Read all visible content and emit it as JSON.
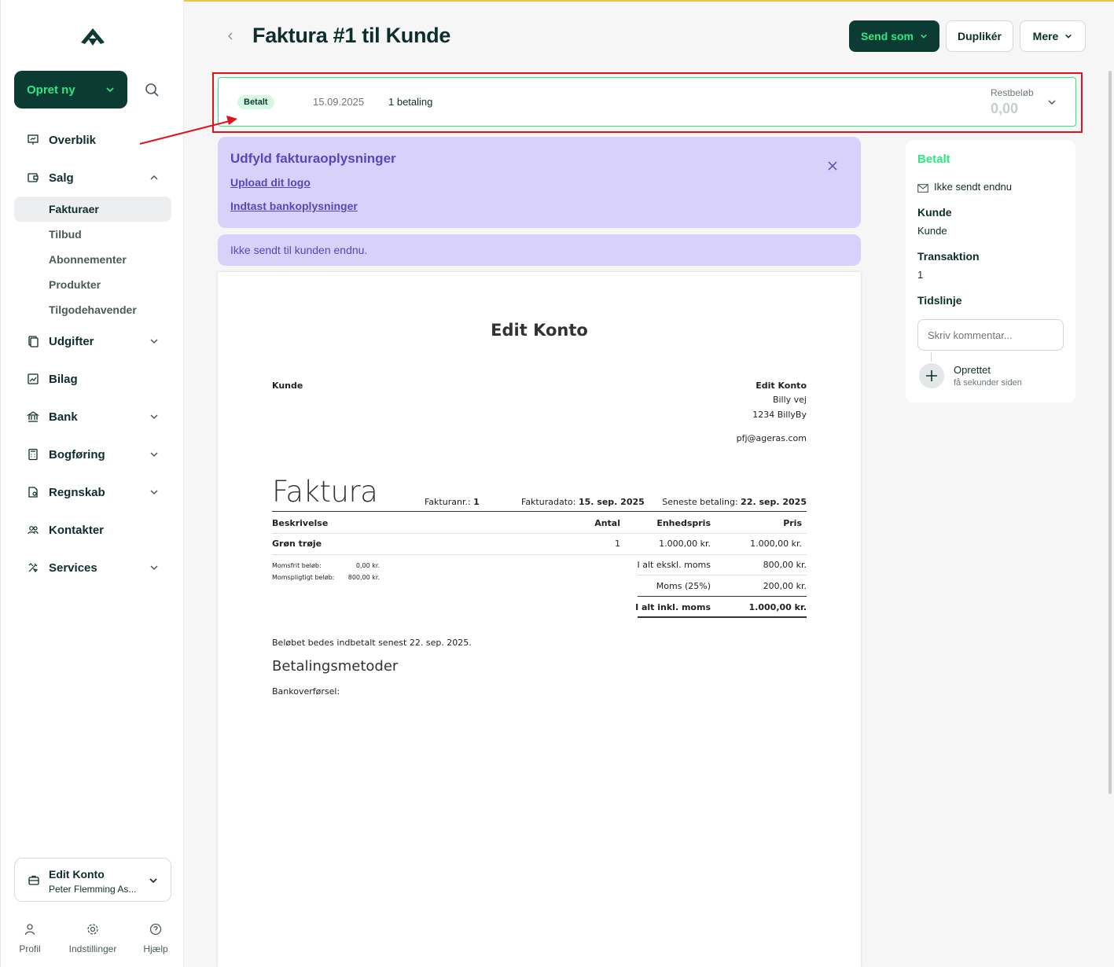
{
  "sidebar": {
    "create_label": "Opret ny",
    "items": [
      {
        "label": "Overblik"
      },
      {
        "label": "Salg"
      },
      {
        "label": "Udgifter"
      },
      {
        "label": "Bilag"
      },
      {
        "label": "Bank"
      },
      {
        "label": "Bogføring"
      },
      {
        "label": "Regnskab"
      },
      {
        "label": "Kontakter"
      },
      {
        "label": "Services"
      }
    ],
    "sub_items": [
      {
        "label": "Fakturaer",
        "active": true
      },
      {
        "label": "Tilbud"
      },
      {
        "label": "Abonnementer"
      },
      {
        "label": "Produkter"
      },
      {
        "label": "Tilgodehavender"
      }
    ],
    "account": {
      "name": "Edit Konto",
      "user": "Peter Flemming As..."
    },
    "bottom": {
      "profile": "Profil",
      "settings": "Indstillinger",
      "help": "Hjælp"
    }
  },
  "header": {
    "title": "Faktura #1 til Kunde",
    "send_label": "Send som",
    "duplicate_label": "Duplikér",
    "more_label": "Mere"
  },
  "status_bar": {
    "badge": "Betalt",
    "date": "15.09.2025",
    "payments": "1 betaling",
    "rest_label": "Restbeløb",
    "rest_value": "0,00"
  },
  "info_panel": {
    "heading": "Udfyld fakturaoplysninger",
    "link_logo": "Upload dit logo",
    "link_bank": "Indtast bankoplysninger"
  },
  "notice": {
    "text": "Ikke sendt til kunden endnu."
  },
  "invoice": {
    "company": "Edit Konto",
    "customer": "Kunde",
    "sender": {
      "name": "Edit Konto",
      "street": "Billy vej",
      "city": "1234 BillyBy",
      "email": "pfj@ageras.com"
    },
    "doc_title": "Faktura",
    "number_label": "Fakturanr.:",
    "number": "1",
    "date_label": "Fakturadato:",
    "date": "15. sep. 2025",
    "due_label": "Seneste betaling:",
    "due": "22. sep. 2025",
    "columns": {
      "desc": "Beskrivelse",
      "qty": "Antal",
      "unit": "Enhedspris",
      "price": "Pris"
    },
    "lines": [
      {
        "desc": "Grøn trøje",
        "qty": "1",
        "unit": "1.000,00 kr.",
        "price": "1.000,00 kr."
      }
    ],
    "vat_info": {
      "free_label": "Momsfrit beløb:",
      "free_value": "0,00 kr.",
      "liable_label": "Momspligtigt beløb:",
      "liable_value": "800,00 kr."
    },
    "totals": {
      "excl_label": "I alt ekskl. moms",
      "excl_value": "800,00 kr.",
      "vat_label": "Moms (25%)",
      "vat_value": "200,00 kr.",
      "incl_label": "I alt inkl. moms",
      "incl_value": "1.000,00 kr."
    },
    "payment_note": "Beløbet bedes indbetalt senest 22. sep. 2025.",
    "payment_methods_title": "Betalingsmetoder",
    "bank_transfer": "Bankoverførsel:"
  },
  "right_panel": {
    "status": "Betalt",
    "sent_status": "Ikke sendt endnu",
    "customer_label": "Kunde",
    "customer_value": "Kunde",
    "transaction_label": "Transaktion",
    "transaction_value": "1",
    "timeline_label": "Tidslinje",
    "comment_placeholder": "Skriv kommentar...",
    "created_label": "Oprettet",
    "created_ago": "få sekunder siden"
  },
  "colors": {
    "brand_dark": "#0b3b33",
    "brand_green": "#2ee882",
    "purple_bg": "#d8d1fa",
    "purple_text": "#5a46b8",
    "highlight": "#e0131d"
  }
}
